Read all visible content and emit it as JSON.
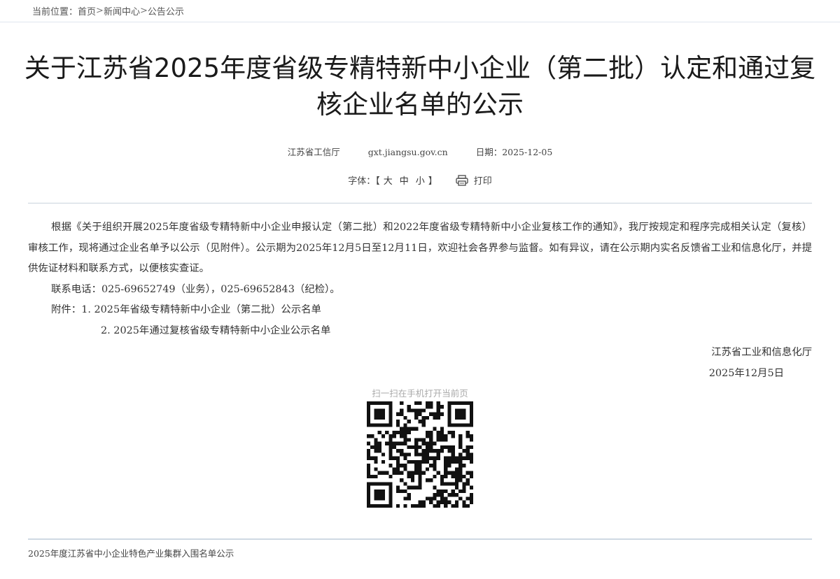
{
  "breadcrumb": {
    "label": "当前位置：",
    "items": [
      "首页",
      "新闻中心",
      "公告公示"
    ],
    "separator": ">"
  },
  "article": {
    "title": "关于江苏省2025年度省级专精特新中小企业（第二批）认定和通过复核企业名单的公示",
    "source": "江苏省工信厅",
    "site": "gxt.jiangsu.gov.cn",
    "date_label": "日期：",
    "date": "2025-12-05"
  },
  "tools": {
    "font_label": "字体：",
    "bracket_open": "【",
    "bracket_close": "】",
    "large": "大",
    "medium": "中",
    "small": "小",
    "print": "打印",
    "print_icon": "printer-icon"
  },
  "content": {
    "para1": "根据《关于组织开展2025年度省级专精特新中小企业申报认定（第二批）和2022年度省级专精特新中小企业复核工作的通知》，我厅按规定和程序完成相关认定（复核）审核工作，现将通过企业名单予以公示（见附件）。公示期为2025年12月5日至12月11日，欢迎社会各界参与监督。如有异议，请在公示期内实名反馈省工业和信息化厅，并提供佐证材料和联系方式，以便核实查证。",
    "contact": "联系电话：025-69652749（业务），025-69652843（纪检）。",
    "attachment_label": "附件：",
    "attachments": [
      "1. 2025年省级专精特新中小企业（第二批）公示名单",
      "2. 2025年通过复核省级专精特新中小企业公示名单"
    ]
  },
  "signature": {
    "org": "江苏省工业和信息化厅",
    "date": "2025年12月5日"
  },
  "qr": {
    "caption": "扫一扫在手机打开当前页"
  },
  "footer": {
    "related_link": "2025年度江苏省中小企业特色产业集群入围名单公示"
  },
  "colors": {
    "rule": "#c9d3dd",
    "caption": "#aaaaaa",
    "text": "#333333"
  }
}
